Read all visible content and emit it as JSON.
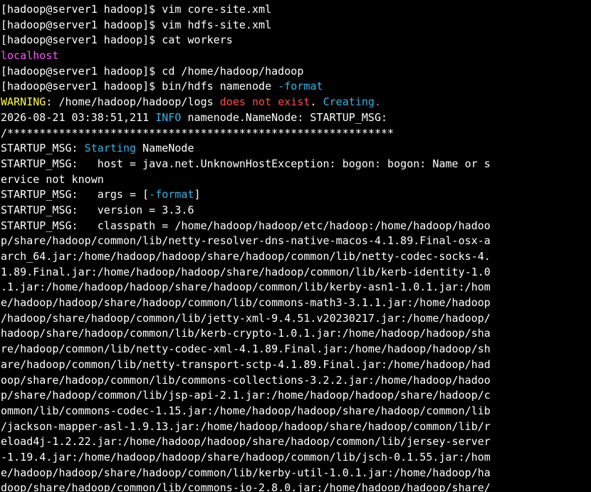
{
  "terminal": {
    "lines": [
      [
        {
          "t": "[hadoop@server1 hadoop]$ vim core-site.xml",
          "c": "default"
        }
      ],
      [
        {
          "t": "[hadoop@server1 hadoop]$ vim hdfs-site.xml",
          "c": "default"
        }
      ],
      [
        {
          "t": "[hadoop@server1 hadoop]$ cat workers",
          "c": "default"
        }
      ],
      [
        {
          "t": "localhost",
          "c": "magenta"
        }
      ],
      [
        {
          "t": "[hadoop@server1 hadoop]$ cd /home/hadoop/hadoop",
          "c": "default"
        }
      ],
      [
        {
          "t": "[hadoop@server1 hadoop]$ bin/hdfs namenode ",
          "c": "default"
        },
        {
          "t": "-format",
          "c": "cyan"
        }
      ],
      [
        {
          "t": "WARNING",
          "c": "yellow"
        },
        {
          "t": ": /home/hadoop/hadoop/logs ",
          "c": "default"
        },
        {
          "t": "does not exist",
          "c": "red"
        },
        {
          "t": ". ",
          "c": "default"
        },
        {
          "t": "Creating.",
          "c": "cyan"
        }
      ],
      [
        {
          "t": "2026-08-21 03:38:51,211 ",
          "c": "default"
        },
        {
          "t": "INFO",
          "c": "cyan"
        },
        {
          "t": " namenode.NameNode: STARTUP_MSG:",
          "c": "default"
        }
      ],
      [
        {
          "t": "/************************************************************",
          "c": "default"
        }
      ],
      [
        {
          "t": "STARTUP_MSG: ",
          "c": "default"
        },
        {
          "t": "Starting",
          "c": "cyan"
        },
        {
          "t": " NameNode",
          "c": "default"
        }
      ],
      [
        {
          "t": "STARTUP_MSG:   host = java.net.UnknownHostException: bogon: bogon: Name or s",
          "c": "default"
        }
      ],
      [
        {
          "t": "ervice not known",
          "c": "default"
        }
      ],
      [
        {
          "t": "STARTUP_MSG:   args = [",
          "c": "default"
        },
        {
          "t": "-format",
          "c": "cyan"
        },
        {
          "t": "]",
          "c": "default"
        }
      ],
      [
        {
          "t": "STARTUP_MSG:   version = 3.3.6",
          "c": "default"
        }
      ],
      [
        {
          "t": "STARTUP_MSG:   classpath = /home/hadoop/hadoop/etc/hadoop:/home/hadoop/hadoo",
          "c": "default"
        }
      ],
      [
        {
          "t": "p/share/hadoop/common/lib/netty-resolver-dns-native-macos-4.1.89.Final-osx-a",
          "c": "default"
        }
      ],
      [
        {
          "t": "arch_64.jar:/home/hadoop/hadoop/share/hadoop/common/lib/netty-codec-socks-4.",
          "c": "default"
        }
      ],
      [
        {
          "t": "1.89.Final.jar:/home/hadoop/hadoop/share/hadoop/common/lib/kerb-identity-1.0",
          "c": "default"
        }
      ],
      [
        {
          "t": ".1.jar:/home/hadoop/hadoop/share/hadoop/common/lib/kerby-asn1-1.0.1.jar:/hom",
          "c": "default"
        }
      ],
      [
        {
          "t": "e/hadoop/hadoop/share/hadoop/common/lib/commons-math3-3.1.1.jar:/home/hadoop",
          "c": "default"
        }
      ],
      [
        {
          "t": "/hadoop/share/hadoop/common/lib/jetty-xml-9.4.51.v20230217.jar:/home/hadoop/",
          "c": "default"
        }
      ],
      [
        {
          "t": "hadoop/share/hadoop/common/lib/kerb-crypto-1.0.1.jar:/home/hadoop/hadoop/sha",
          "c": "default"
        }
      ],
      [
        {
          "t": "re/hadoop/common/lib/netty-codec-xml-4.1.89.Final.jar:/home/hadoop/hadoop/sh",
          "c": "default"
        }
      ],
      [
        {
          "t": "are/hadoop/common/lib/netty-transport-sctp-4.1.89.Final.jar:/home/hadoop/had",
          "c": "default"
        }
      ],
      [
        {
          "t": "oop/share/hadoop/common/lib/commons-collections-3.2.2.jar:/home/hadoop/hadoo",
          "c": "default"
        }
      ],
      [
        {
          "t": "p/share/hadoop/common/lib/jsp-api-2.1.jar:/home/hadoop/hadoop/share/hadoop/c",
          "c": "default"
        }
      ],
      [
        {
          "t": "ommon/lib/commons-codec-1.15.jar:/home/hadoop/hadoop/share/hadoop/common/lib",
          "c": "default"
        }
      ],
      [
        {
          "t": "/jackson-mapper-asl-1.9.13.jar:/home/hadoop/hadoop/share/hadoop/common/lib/r",
          "c": "default"
        }
      ],
      [
        {
          "t": "eload4j-1.2.22.jar:/home/hadoop/hadoop/share/hadoop/common/lib/jersey-server",
          "c": "default"
        }
      ],
      [
        {
          "t": "-1.19.4.jar:/home/hadoop/hadoop/share/hadoop/common/lib/jsch-0.1.55.jar:/hom",
          "c": "default"
        }
      ],
      [
        {
          "t": "e/hadoop/hadoop/share/hadoop/common/lib/kerby-util-1.0.1.jar:/home/hadoop/ha",
          "c": "default"
        }
      ],
      [
        {
          "t": "doop/share/hadoop/common/lib/commons-io-2.8.0.jar:/home/hadoop/hadoop/share/",
          "c": "default"
        }
      ]
    ]
  },
  "colors": {
    "background": "#000000",
    "default": "#ffffff",
    "magenta": "#ff55ff",
    "cyan": "#33b4e8",
    "yellow": "#ffff33",
    "red": "#ff4a4a"
  }
}
